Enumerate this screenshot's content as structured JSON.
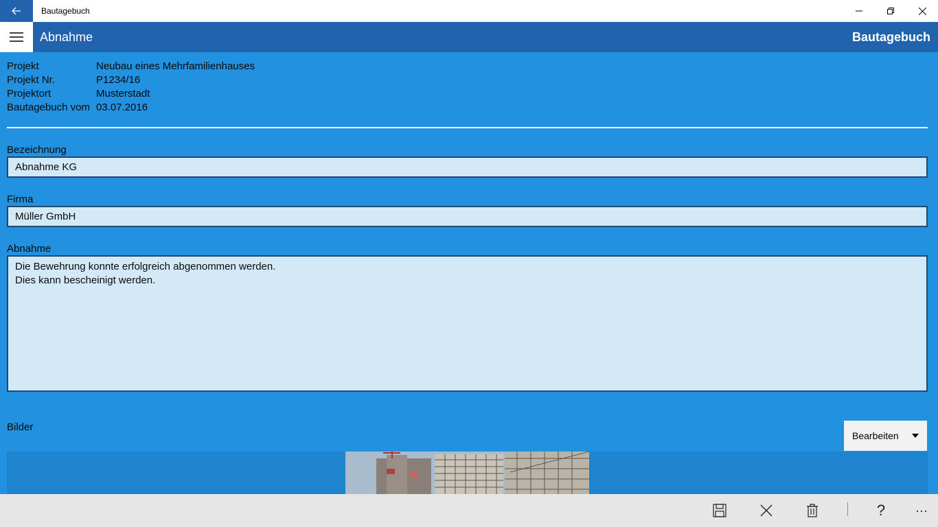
{
  "window": {
    "title": "Bautagebuch"
  },
  "header": {
    "page_title": "Abnahme",
    "app_name": "Bautagebuch"
  },
  "project_info": [
    {
      "label": "Projekt",
      "value": "Neubau eines Mehrfamilienhauses"
    },
    {
      "label": "Projekt Nr.",
      "value": "P1234/16"
    },
    {
      "label": "Projektort",
      "value": "Musterstadt"
    },
    {
      "label": "Bautagebuch vom",
      "value": "03.07.2016"
    }
  ],
  "fields": {
    "bezeichnung": {
      "label": "Bezeichnung",
      "value": "Abnahme KG"
    },
    "firma": {
      "label": "Firma",
      "value": "Müller GmbH"
    },
    "abnahme": {
      "label": "Abnahme",
      "lines": [
        "Die Bewehrung konnte erfolgreich abgenommen werden.",
        "Dies kann bescheinigt werden."
      ]
    }
  },
  "images": {
    "label": "Bilder",
    "edit_dropdown": "Bearbeiten",
    "photo_name": "construction-site-photo"
  },
  "command_bar": {
    "save_icon": "save-icon",
    "cancel_icon": "close-icon",
    "delete_icon": "trash-icon",
    "help_label": "?",
    "more_label": "···"
  },
  "colors": {
    "accent": "#2263ad",
    "background": "#2291e0",
    "input_bg": "#d4e9f7",
    "command_bar": "#e6e6e6"
  }
}
